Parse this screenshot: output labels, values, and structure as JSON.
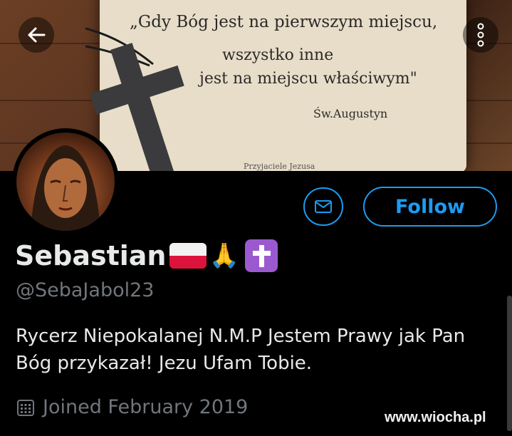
{
  "banner": {
    "quote_line1": "„Gdy Bóg jest na pierwszym miejscu,",
    "quote_line2": "wszystko inne",
    "quote_line3": "jest na miejscu właściwym\"",
    "quote_author": "Św.Augustyn",
    "quote_footer": "Przyjaciele Jezusa"
  },
  "header": {
    "back_icon": "arrow-left-icon",
    "more_icon": "more-vertical-icon"
  },
  "profile": {
    "display_name": "Sebastian",
    "name_emojis": [
      "flag-poland",
      "folded-hands",
      "latin-cross"
    ],
    "handle": "@SebaJabol23",
    "bio": "Rycerz Niepokalanej N.M.P Jestem Prawy jak Pan Bóg przykazał! Jezu Ufam Tobie.",
    "joined": "Joined February 2019"
  },
  "actions": {
    "message_icon": "envelope-icon",
    "follow_label": "Follow"
  },
  "watermark": "www.wiocha.pl",
  "colors": {
    "accent": "#1d9bf0",
    "background": "#000000",
    "text": "#e7e9ea",
    "muted": "#71767b"
  }
}
